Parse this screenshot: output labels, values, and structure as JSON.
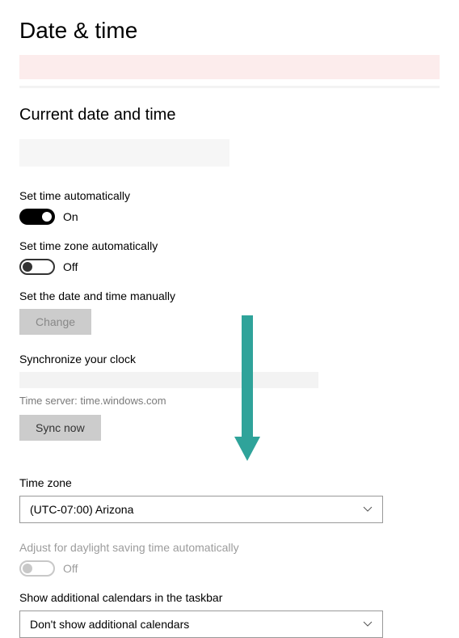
{
  "title": "Date & time",
  "sectionTitle": "Current date and time",
  "settings": {
    "setTimeAuto": {
      "label": "Set time automatically",
      "state": "On"
    },
    "setTzAuto": {
      "label": "Set time zone automatically",
      "state": "Off"
    },
    "manualLabel": "Set the date and time manually",
    "changeBtn": "Change",
    "syncLabel": "Synchronize your clock",
    "timeServer": "Time server: time.windows.com",
    "syncBtn": "Sync now",
    "tzLabel": "Time zone",
    "tzValue": "(UTC-07:00) Arizona",
    "dstLabel": "Adjust for daylight saving time automatically",
    "dstState": "Off",
    "calLabel": "Show additional calendars in the taskbar",
    "calValue": "Don't show additional calendars"
  }
}
